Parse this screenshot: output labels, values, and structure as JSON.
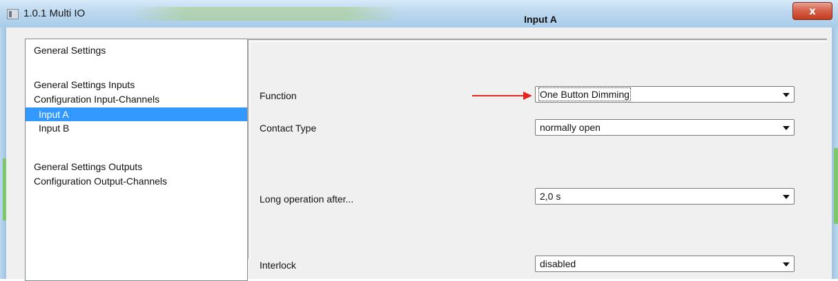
{
  "window": {
    "title": "1.0.1 Multi IO",
    "close_label": "x"
  },
  "tree": {
    "items": [
      {
        "label": "General Settings"
      },
      {
        "label": "General Settings Inputs"
      },
      {
        "label": "Configuration Input-Channels"
      },
      {
        "label": "Input  A",
        "selected": true
      },
      {
        "label": "Input  B"
      },
      {
        "label": "General Settings Outputs"
      },
      {
        "label": "Configuration Output-Channels"
      }
    ]
  },
  "page": {
    "title": "Input  A"
  },
  "parameters": [
    {
      "label": "Function",
      "value": "One Button Dimming"
    },
    {
      "label": "Contact Type",
      "value": "normally open"
    },
    {
      "label": "Long operation after...",
      "value": "2,0 s"
    },
    {
      "label": "Interlock",
      "value": "disabled"
    }
  ],
  "colors": {
    "selection": "#3399ff",
    "annotation_arrow": "#e52323"
  },
  "icons": {
    "app": "app-window-icon",
    "combo": "dropdown-arrow-icon",
    "annotation": "red-arrow-icon"
  }
}
